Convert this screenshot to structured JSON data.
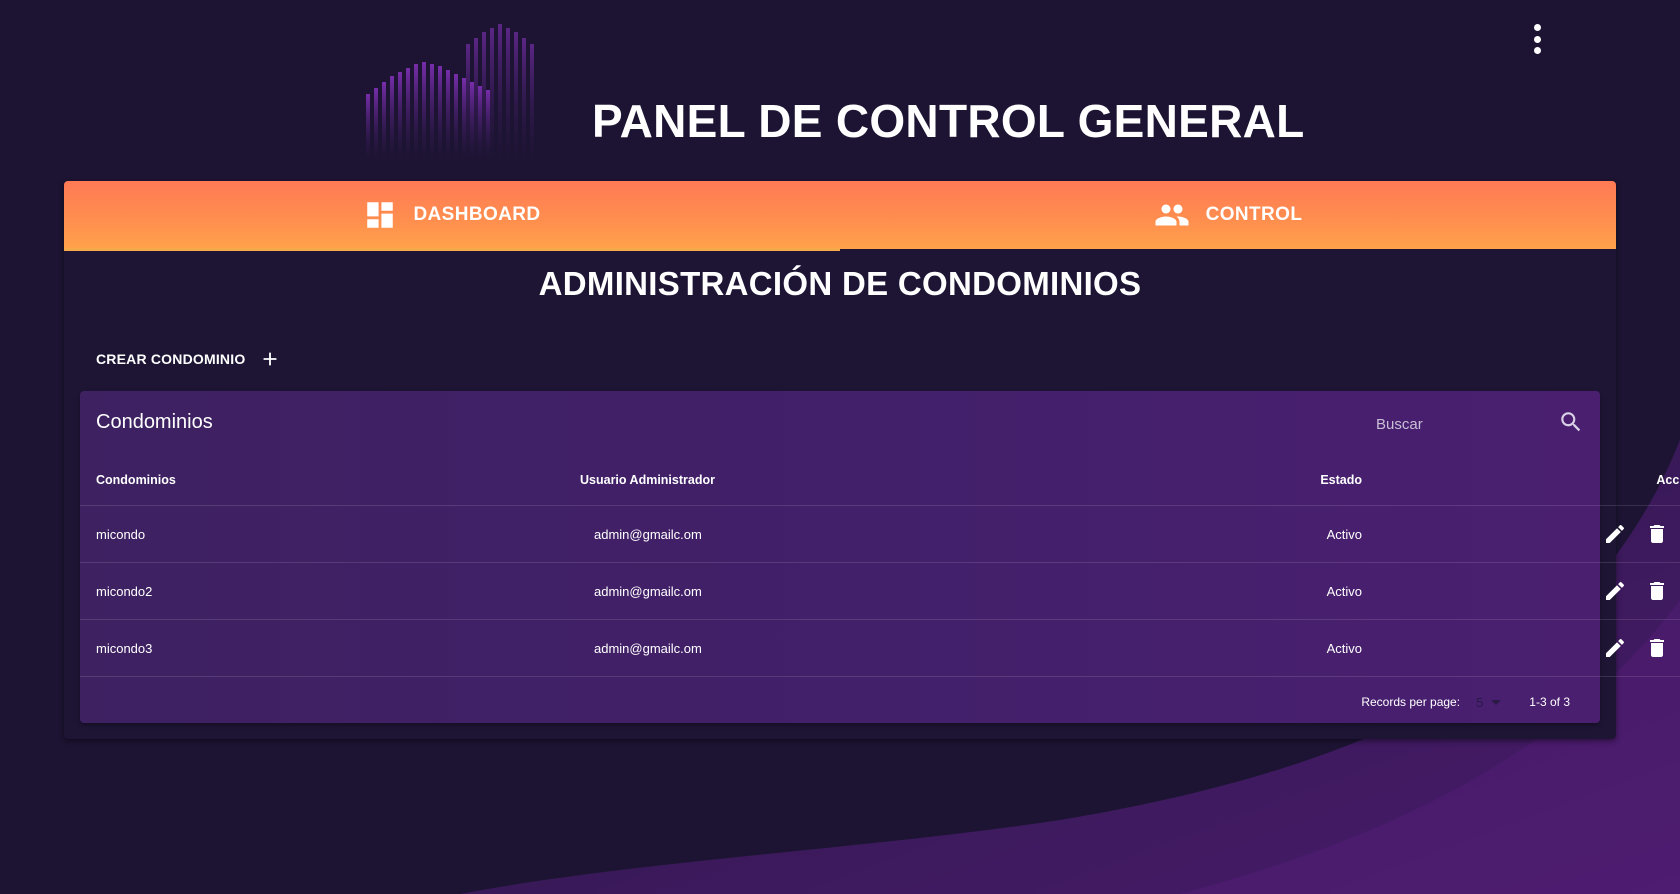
{
  "app": {
    "title": "PANEL DE CONTROL GENERAL",
    "menu_icon": "more-vert-icon",
    "logo_icon": "building-bars-logo"
  },
  "tabs": [
    {
      "label": "DASHBOARD",
      "icon": "dashboard-icon"
    },
    {
      "label": "CONTROL",
      "icon": "people-icon"
    }
  ],
  "section": {
    "title": "ADMINISTRACIÓN DE CONDOMINIOS",
    "create_label": "CREAR CONDOMINIO",
    "create_icon": "plus-icon"
  },
  "table": {
    "title": "Condominios",
    "search_placeholder": "Buscar",
    "columns": [
      "Condominios",
      "Usuario Administrador",
      "Estado",
      "Acciones"
    ],
    "rows": [
      {
        "name": "micondo",
        "admin": "admin@gmailc.om",
        "state": "Activo"
      },
      {
        "name": "micondo2",
        "admin": "admin@gmailc.om",
        "state": "Activo"
      },
      {
        "name": "micondo3",
        "admin": "admin@gmailc.om",
        "state": "Activo"
      }
    ],
    "actions": [
      "edit-icon",
      "delete-icon",
      "block-icon"
    ],
    "footer": {
      "records_label": "Records per page:",
      "records_value": "5",
      "range": "1-3 of 3"
    }
  },
  "colors": {
    "background": "#1d1433",
    "tab_gradient_top": "#ff7a55",
    "tab_gradient_bottom": "#ffa24a",
    "table_panel": "#42206a",
    "swoosh": "#4b1c6e"
  }
}
